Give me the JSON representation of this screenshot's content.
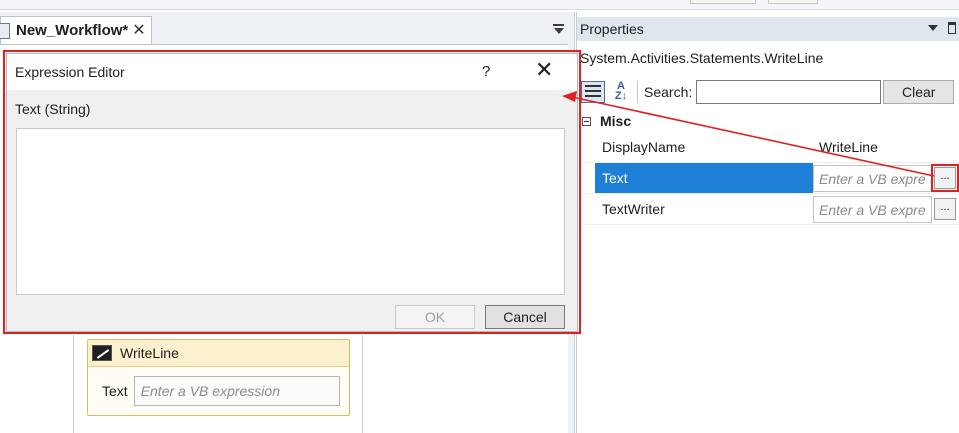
{
  "document": {
    "tab_title": "New_Workflow*",
    "tab_close_glyph": "✕"
  },
  "designer": {
    "activity": {
      "title": "WriteLine",
      "field_label": "Text",
      "field_placeholder": "Enter a VB expression"
    }
  },
  "properties": {
    "panel_title": "Properties",
    "type_name": "System.Activities.Statements.WriteLine",
    "search_label": "Search:",
    "search_value": "",
    "clear_label": "Clear",
    "sort_az_label": "A\nZ",
    "category": "Misc",
    "rows": [
      {
        "name": "DisplayName",
        "value": "WriteLine",
        "placeholder": ""
      },
      {
        "name": "Text",
        "value": "",
        "placeholder": "Enter a VB expre",
        "selected": true
      },
      {
        "name": "TextWriter",
        "value": "",
        "placeholder": "Enter a VB expre"
      }
    ],
    "ellipsis_label": "..."
  },
  "dialog": {
    "title": "Expression Editor",
    "help_glyph": "?",
    "close_glyph": "✕",
    "field_label": "Text (String)",
    "expression_value": "",
    "ok_label": "OK",
    "cancel_label": "Cancel"
  },
  "colors": {
    "highlight": "#e02020",
    "selection": "#1e7fd6",
    "activity_border": "#d7b96a"
  }
}
